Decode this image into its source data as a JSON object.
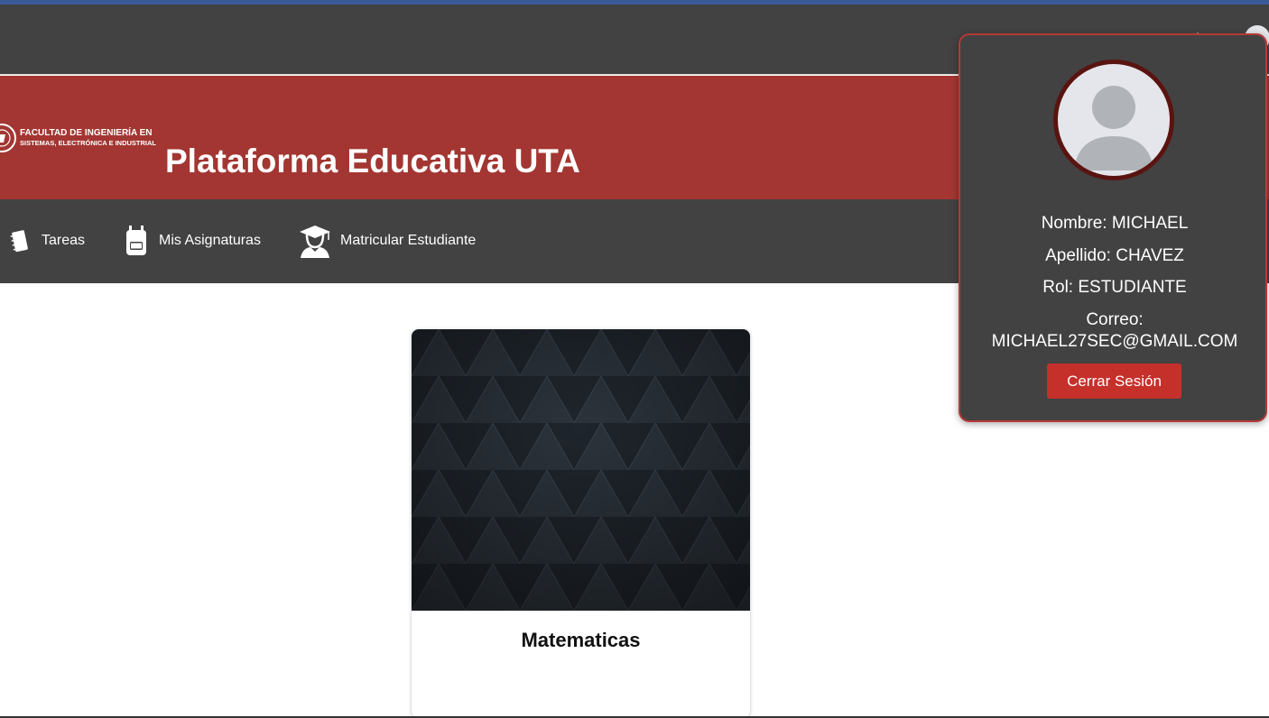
{
  "header": {
    "logo_line1": "FACULTAD DE INGENIERÍA EN",
    "logo_line2": "SISTEMAS, ELECTRÓNICA E INDUSTRIAL",
    "title": "Plataforma Educativa UTA"
  },
  "nav": {
    "items": [
      {
        "label": "Tareas",
        "icon": "notebook-icon"
      },
      {
        "label": "Mis Asignaturas",
        "icon": "backpack-icon"
      },
      {
        "label": "Matricular Estudiante",
        "icon": "graduate-icon"
      }
    ]
  },
  "courses": [
    {
      "title": "Matematicas"
    }
  ],
  "profile": {
    "nombre": "Nombre: MICHAEL",
    "apellido": "Apellido: CHAVEZ",
    "rol": "Rol: ESTUDIANTE",
    "correo_label": "Correo:",
    "correo": "MICHAEL27SEC@GMAIL.COM",
    "logout_label": "Cerrar Sesión"
  },
  "colors": {
    "brand_red": "#a33632",
    "dark_bar": "#424242",
    "logout_button": "#c5302b",
    "top_accent": "#3b5a9a"
  }
}
